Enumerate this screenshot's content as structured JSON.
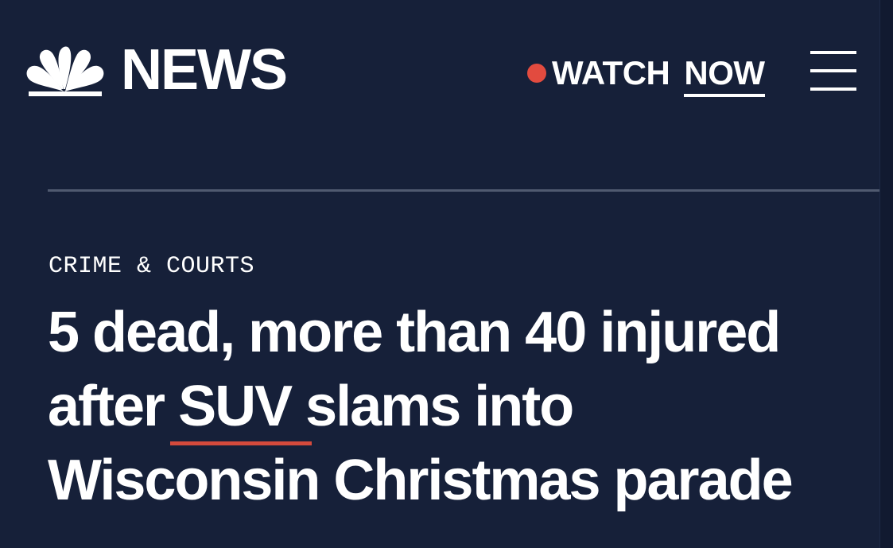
{
  "header": {
    "logo_text": "NEWS",
    "watch_label": "WATCH",
    "now_label": "NOW"
  },
  "article": {
    "category": "CRIME & COURTS",
    "headline": {
      "line1": "5 dead, more than 40 injured",
      "line2_before": "after ",
      "line2_link": "SUV",
      "line2_after": " slams into",
      "line3": "Wisconsin Christmas parade"
    }
  },
  "colors": {
    "background": "#162039",
    "live_dot": "#e24b3f",
    "link_underline": "#d44a3c",
    "divider": "#505a70",
    "text": "#ffffff"
  },
  "icons": {
    "logo": "nbc-peacock-icon",
    "menu": "hamburger-menu-icon",
    "live": "live-dot-icon"
  }
}
